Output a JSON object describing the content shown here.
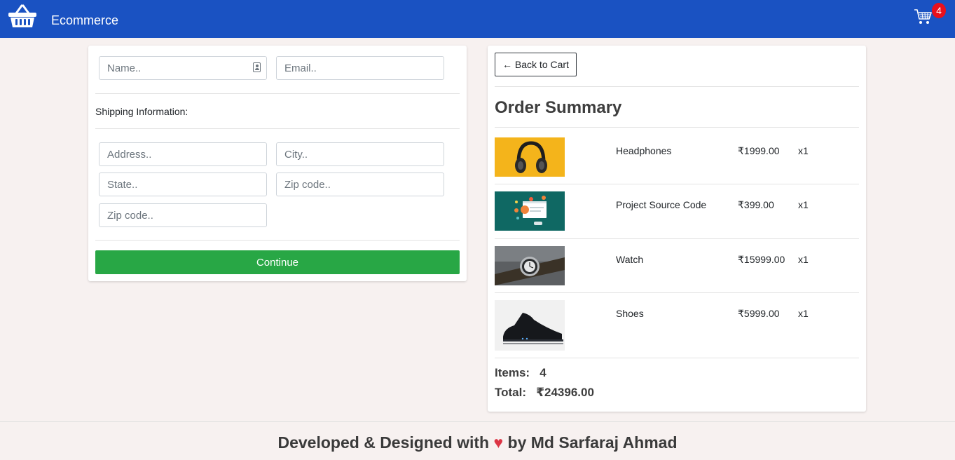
{
  "brand": {
    "name": "Ecommerce",
    "logo_icon": "shopping-basket-icon"
  },
  "cart": {
    "icon": "shopping-cart-icon",
    "count": "4"
  },
  "form": {
    "name_placeholder": "Name..",
    "email_placeholder": "Email..",
    "shipping_label": "Shipping Information:",
    "address_placeholder": "Address..",
    "city_placeholder": "City..",
    "state_placeholder": "State..",
    "zip_placeholder": "Zip code..",
    "zip2_placeholder": "Zip code..",
    "continue_label": "Continue"
  },
  "summary": {
    "back_label": "← Back to Cart",
    "title": "Order Summary",
    "items": [
      {
        "name": "Headphones",
        "price": "₹1999.00",
        "qty": "x1"
      },
      {
        "name": "Project Source Code",
        "price": "₹399.00",
        "qty": "x1"
      },
      {
        "name": "Watch",
        "price": "₹15999.00",
        "qty": "x1"
      },
      {
        "name": "Shoes",
        "price": "₹5999.00",
        "qty": "x1"
      }
    ],
    "items_text": "Items:   4",
    "total_text": "Total:   ₹24396.00"
  },
  "footer": {
    "text_before": "Developed & Designed with ",
    "heart": "♥",
    "text_after": " by Md Sarfaraj Ahmad"
  },
  "colors": {
    "navbar": "#1a52c2",
    "background": "#f7f1f0",
    "continue_button": "#28a745",
    "badge": "#e8101d",
    "heart": "#dc3545"
  }
}
